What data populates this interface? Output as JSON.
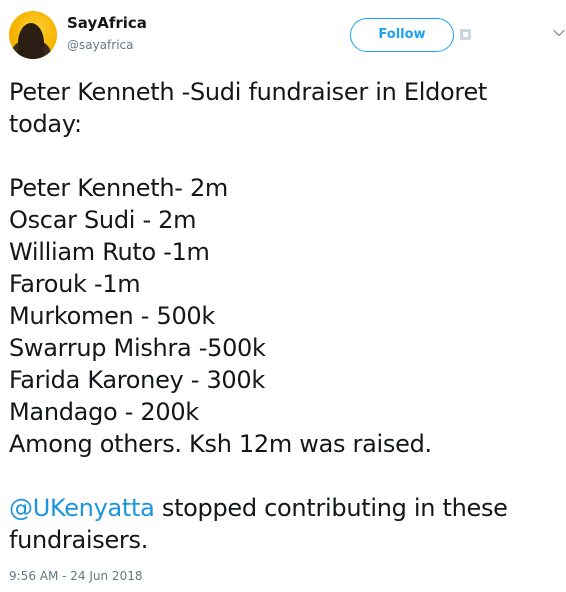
{
  "author": {
    "display_name": "SayAfrica",
    "handle": "@sayafrica"
  },
  "follow_button": {
    "label": "Follow"
  },
  "tweet": {
    "intro_line1": "Peter Kenneth -Sudi fundraiser in Eldoret",
    "intro_line2": "today:",
    "contributions": [
      "Peter Kenneth- 2m",
      "Oscar Sudi - 2m",
      "William Ruto -1m",
      "Farouk -1m",
      "Murkomen - 500k",
      "Swarrup Mishra -500k",
      "Farida Karoney - 300k",
      "Mandago - 200k",
      "Among others. Ksh 12m was raised."
    ],
    "mention": "@UKenyatta",
    "closing_line1_rest": " stopped contributing in these",
    "closing_line2": "fundraisers."
  },
  "timestamp": "9:56 AM - 24 Jun 2018",
  "icons": {
    "avatar": "avatar-image",
    "profile": "profile-card-icon",
    "more": "chevron-down-icon"
  },
  "colors": {
    "follow_accent": "#1da1f2",
    "mention": "#1b95e0",
    "secondary_text": "#657786",
    "primary_text": "#14171a"
  }
}
